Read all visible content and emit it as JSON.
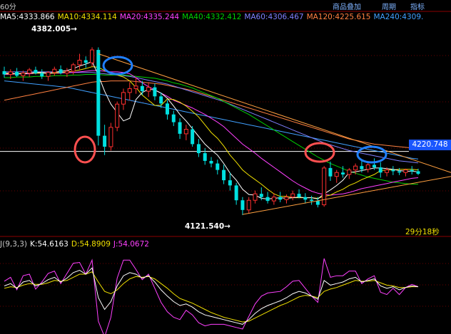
{
  "header": {
    "timeframe": "60分",
    "menu": [
      "商品叠加",
      "周期",
      "指标"
    ]
  },
  "indicators": {
    "ma": [
      {
        "label": "MA5:4333.866",
        "color": "#ffffff"
      },
      {
        "label": "MA10:4334.114",
        "color": "#f0e000"
      },
      {
        "label": "MA20:4335.244",
        "color": "#ff40ff"
      },
      {
        "label": "MA40:4332.412",
        "color": "#00d000"
      },
      {
        "label": "MA60:4306.467",
        "color": "#8080ff"
      },
      {
        "label": "MA120:4225.615",
        "color": "#ff8040"
      },
      {
        "label": "MA240:4309.",
        "color": "#40a0ff"
      }
    ]
  },
  "annotations": {
    "high_price": "4382.005",
    "low_price": "4121.540",
    "ref_price": "4220.748",
    "timer": "29分18秒"
  },
  "kdj": {
    "title": "J(9,3,3)",
    "k": "K:54.6163",
    "d": "D:54.8909",
    "j": "J:54.0672",
    "k_color": "#ffffff",
    "d_color": "#f0e000",
    "j_color": "#ff40ff"
  },
  "chart_data": {
    "type": "candlestick",
    "price_range": [
      4100,
      4420
    ],
    "kdj_range": [
      0,
      100
    ],
    "candles": [
      [
        4345,
        4352,
        4335,
        4340
      ],
      [
        4340,
        4348,
        4333,
        4344
      ],
      [
        4344,
        4350,
        4336,
        4338
      ],
      [
        4338,
        4346,
        4330,
        4342
      ],
      [
        4342,
        4350,
        4336,
        4347
      ],
      [
        4347,
        4352,
        4340,
        4342
      ],
      [
        4342,
        4348,
        4333,
        4337
      ],
      [
        4337,
        4345,
        4330,
        4343
      ],
      [
        4343,
        4352,
        4338,
        4348
      ],
      [
        4348,
        4354,
        4340,
        4342
      ],
      [
        4342,
        4350,
        4336,
        4345
      ],
      [
        4345,
        4358,
        4340,
        4355
      ],
      [
        4355,
        4372,
        4348,
        4362
      ],
      [
        4362,
        4368,
        4350,
        4358
      ],
      [
        4358,
        4382,
        4352,
        4378
      ],
      [
        4378,
        4382,
        4230,
        4245
      ],
      [
        4245,
        4262,
        4215,
        4228
      ],
      [
        4228,
        4265,
        4222,
        4258
      ],
      [
        4258,
        4298,
        4252,
        4294
      ],
      [
        4294,
        4318,
        4285,
        4312
      ],
      [
        4312,
        4328,
        4300,
        4318
      ],
      [
        4318,
        4335,
        4310,
        4322
      ],
      [
        4322,
        4330,
        4308,
        4314
      ],
      [
        4314,
        4328,
        4305,
        4320
      ],
      [
        4320,
        4326,
        4300,
        4306
      ],
      [
        4306,
        4312,
        4288,
        4295
      ],
      [
        4295,
        4300,
        4270,
        4278
      ],
      [
        4278,
        4284,
        4260,
        4266
      ],
      [
        4266,
        4272,
        4240,
        4248
      ],
      [
        4248,
        4262,
        4238,
        4255
      ],
      [
        4255,
        4260,
        4228,
        4232
      ],
      [
        4232,
        4240,
        4212,
        4218
      ],
      [
        4218,
        4226,
        4200,
        4206
      ],
      [
        4206,
        4212,
        4196,
        4202
      ],
      [
        4202,
        4208,
        4185,
        4192
      ],
      [
        4192,
        4200,
        4170,
        4176
      ],
      [
        4176,
        4188,
        4160,
        4168
      ],
      [
        4168,
        4172,
        4138,
        4145
      ],
      [
        4145,
        4150,
        4122,
        4130
      ],
      [
        4130,
        4150,
        4125,
        4145
      ],
      [
        4145,
        4160,
        4140,
        4155
      ],
      [
        4155,
        4165,
        4145,
        4150
      ],
      [
        4150,
        4158,
        4140,
        4144
      ],
      [
        4144,
        4156,
        4138,
        4150
      ],
      [
        4150,
        4158,
        4142,
        4146
      ],
      [
        4146,
        4154,
        4140,
        4150
      ],
      [
        4150,
        4160,
        4145,
        4155
      ],
      [
        4155,
        4162,
        4148,
        4150
      ],
      [
        4150,
        4156,
        4140,
        4146
      ],
      [
        4146,
        4152,
        4138,
        4144
      ],
      [
        4144,
        4150,
        4134,
        4138
      ],
      [
        4138,
        4198,
        4135,
        4195
      ],
      [
        4195,
        4205,
        4175,
        4182
      ],
      [
        4182,
        4192,
        4172,
        4188
      ],
      [
        4188,
        4198,
        4180,
        4185
      ],
      [
        4185,
        4195,
        4178,
        4192
      ],
      [
        4192,
        4202,
        4185,
        4198
      ],
      [
        4198,
        4206,
        4188,
        4193
      ],
      [
        4193,
        4204,
        4188,
        4200
      ],
      [
        4200,
        4210,
        4192,
        4196
      ],
      [
        4196,
        4204,
        4180,
        4188
      ],
      [
        4188,
        4196,
        4182,
        4192
      ],
      [
        4192,
        4198,
        4184,
        4190
      ],
      [
        4190,
        4195,
        4184,
        4188
      ],
      [
        4188,
        4194,
        4182,
        4192
      ],
      [
        4192,
        4198,
        4185,
        4190
      ],
      [
        4190,
        4194,
        4184,
        4186
      ]
    ],
    "kdj_k": [
      55,
      58,
      52,
      60,
      62,
      55,
      58,
      63,
      66,
      60,
      65,
      72,
      75,
      70,
      78,
      40,
      25,
      35,
      55,
      68,
      72,
      70,
      65,
      68,
      60,
      50,
      42,
      35,
      30,
      32,
      28,
      22,
      18,
      16,
      14,
      12,
      10,
      8,
      6,
      12,
      20,
      26,
      30,
      33,
      36,
      40,
      45,
      48,
      46,
      42,
      38,
      62,
      56,
      58,
      60,
      64,
      66,
      60,
      62,
      64,
      55,
      52,
      54,
      50,
      53,
      55,
      54
    ],
    "kdj_d": [
      52,
      54,
      53,
      56,
      58,
      57,
      57,
      59,
      62,
      61,
      62,
      66,
      70,
      70,
      73,
      60,
      48,
      45,
      50,
      58,
      64,
      67,
      66,
      67,
      64,
      58,
      52,
      45,
      39,
      36,
      33,
      29,
      25,
      21,
      18,
      15,
      13,
      11,
      9,
      10,
      14,
      18,
      22,
      26,
      30,
      33,
      37,
      41,
      43,
      42,
      40,
      48,
      51,
      53,
      56,
      59,
      62,
      61,
      61,
      62,
      59,
      56,
      55,
      53,
      53,
      54,
      54
    ],
    "kdj_j": [
      61,
      66,
      50,
      68,
      70,
      51,
      60,
      71,
      74,
      58,
      71,
      84,
      85,
      70,
      88,
      10,
      -10,
      15,
      65,
      88,
      88,
      76,
      63,
      70,
      52,
      34,
      22,
      15,
      12,
      24,
      18,
      8,
      4,
      6,
      6,
      6,
      4,
      2,
      0,
      16,
      32,
      42,
      46,
      47,
      48,
      54,
      61,
      62,
      52,
      42,
      34,
      90,
      66,
      68,
      68,
      74,
      74,
      58,
      64,
      68,
      47,
      44,
      52,
      44,
      53,
      57,
      54
    ],
    "ma5": [
      4342,
      4342,
      4341,
      4341,
      4342,
      4343,
      4343,
      4342,
      4343,
      4345,
      4346,
      4349,
      4353,
      4356,
      4360,
      4339,
      4314,
      4294,
      4281,
      4268,
      4272,
      4301,
      4312,
      4317,
      4316,
      4311,
      4303,
      4291,
      4278,
      4268,
      4256,
      4244,
      4232,
      4223,
      4215,
      4202,
      4187,
      4176,
      4162,
      4154,
      4153,
      4148,
      4147,
      4148,
      4149,
      4148,
      4149,
      4150,
      4149,
      4149,
      4147,
      4155,
      4161,
      4168,
      4176,
      4188,
      4189,
      4191,
      4193,
      4195,
      4195,
      4194,
      4193,
      4191,
      4190,
      4190,
      4189
    ],
    "ma10": [
      4341,
      4341,
      4341,
      4342,
      4342,
      4342,
      4342,
      4342,
      4342,
      4343,
      4344,
      4345,
      4347,
      4349,
      4352,
      4351,
      4346,
      4342,
      4339,
      4336,
      4330,
      4320,
      4308,
      4300,
      4292,
      4292,
      4302,
      4301,
      4297,
      4291,
      4283,
      4274,
      4262,
      4250,
      4241,
      4229,
      4215,
      4204,
      4192,
      4184,
      4177,
      4170,
      4162,
      4155,
      4151,
      4151,
      4149,
      4149,
      4149,
      4149,
      4148,
      4151,
      4153,
      4158,
      4162,
      4168,
      4172,
      4177,
      4181,
      4185,
      4191,
      4192,
      4192,
      4193,
      4193,
      4193,
      4192
    ],
    "ma20": [
      4340,
      4340,
      4341,
      4341,
      4341,
      4342,
      4342,
      4342,
      4342,
      4342,
      4343,
      4343,
      4344,
      4345,
      4346,
      4346,
      4345,
      4344,
      4344,
      4343,
      4341,
      4335,
      4327,
      4321,
      4316,
      4311,
      4306,
      4300,
      4296,
      4292,
      4288,
      4283,
      4278,
      4272,
      4266,
      4259,
      4250,
      4241,
      4232,
      4225,
      4218,
      4210,
      4203,
      4196,
      4189,
      4182,
      4175,
      4169,
      4164,
      4159,
      4156,
      4154,
      4153,
      4154,
      4155,
      4157,
      4160,
      4163,
      4165,
      4167,
      4169,
      4171,
      4173,
      4175,
      4177,
      4179,
      4180
    ],
    "ma40": [
      4335,
      4335,
      4336,
      4336,
      4336,
      4337,
      4337,
      4337,
      4338,
      4338,
      4338,
      4339,
      4339,
      4340,
      4340,
      4340,
      4339,
      4339,
      4339,
      4339,
      4338,
      4337,
      4336,
      4335,
      4334,
      4332,
      4330,
      4327,
      4325,
      4322,
      4319,
      4315,
      4311,
      4307,
      4303,
      4298,
      4293,
      4288,
      4283,
      4278,
      4272,
      4266,
      4260,
      4254,
      4248,
      4242,
      4236,
      4230,
      4224,
      4218,
      4212,
      4207,
      4202,
      4198,
      4194,
      4190,
      4187,
      4184,
      4181,
      4179,
      4177,
      4175,
      4173,
      4172,
      4171,
      4170,
      4170
    ],
    "ma60": [
      4344,
      4344,
      4344,
      4344,
      4344,
      4344,
      4344,
      4344,
      4344,
      4344,
      4343,
      4343,
      4343,
      4343,
      4343,
      4342,
      4341,
      4340,
      4339,
      4338,
      4337,
      4335,
      4333,
      4331,
      4329,
      4327,
      4325,
      4322,
      4319,
      4316,
      4313,
      4310,
      4307,
      4304,
      4301,
      4298,
      4294,
      4290,
      4286,
      4282,
      4278,
      4274,
      4270,
      4266,
      4262,
      4258,
      4254,
      4250,
      4246,
      4242,
      4238,
      4234,
      4231,
      4228,
      4225,
      4222,
      4220,
      4218,
      4216,
      4214,
      4212,
      4210,
      4208,
      4206,
      4205,
      4204,
      4203
    ],
    "ma120": [
      4300,
      4302,
      4304,
      4306,
      4308,
      4310,
      4312,
      4314,
      4316,
      4318,
      4320,
      4322,
      4324,
      4326,
      4328,
      4329,
      4329,
      4330,
      4330,
      4330,
      4330,
      4329,
      4328,
      4327,
      4326,
      4325,
      4323,
      4321,
      4319,
      4317,
      4315,
      4312,
      4309,
      4306,
      4303,
      4300,
      4297,
      4294,
      4291,
      4288,
      4285,
      4282,
      4279,
      4276,
      4273,
      4270,
      4267,
      4264,
      4261,
      4258,
      4255,
      4252,
      4249,
      4246,
      4243,
      4240,
      4238,
      4236,
      4234,
      4232,
      4231,
      4230,
      4229,
      4228,
      4227,
      4226,
      4226
    ],
    "ma240": [
      4330,
      4329,
      4328,
      4327,
      4326,
      4325,
      4324,
      4323,
      4322,
      4321,
      4320,
      4318,
      4316,
      4314,
      4312,
      4310,
      4308,
      4306,
      4304,
      4302,
      4300,
      4298,
      4296,
      4294,
      4292,
      4290,
      4288,
      4286,
      4284,
      4282,
      4280,
      4278,
      4276,
      4274,
      4272,
      4270,
      4268,
      4266,
      4264,
      4262,
      4260,
      4258,
      4256,
      4254,
      4252,
      4250,
      4248,
      4246,
      4244,
      4242,
      4240,
      4238,
      4236,
      4234,
      4232,
      4230,
      4228,
      4226,
      4224,
      4222,
      4220,
      4218,
      4216,
      4214,
      4212,
      4210,
      4209
    ]
  }
}
